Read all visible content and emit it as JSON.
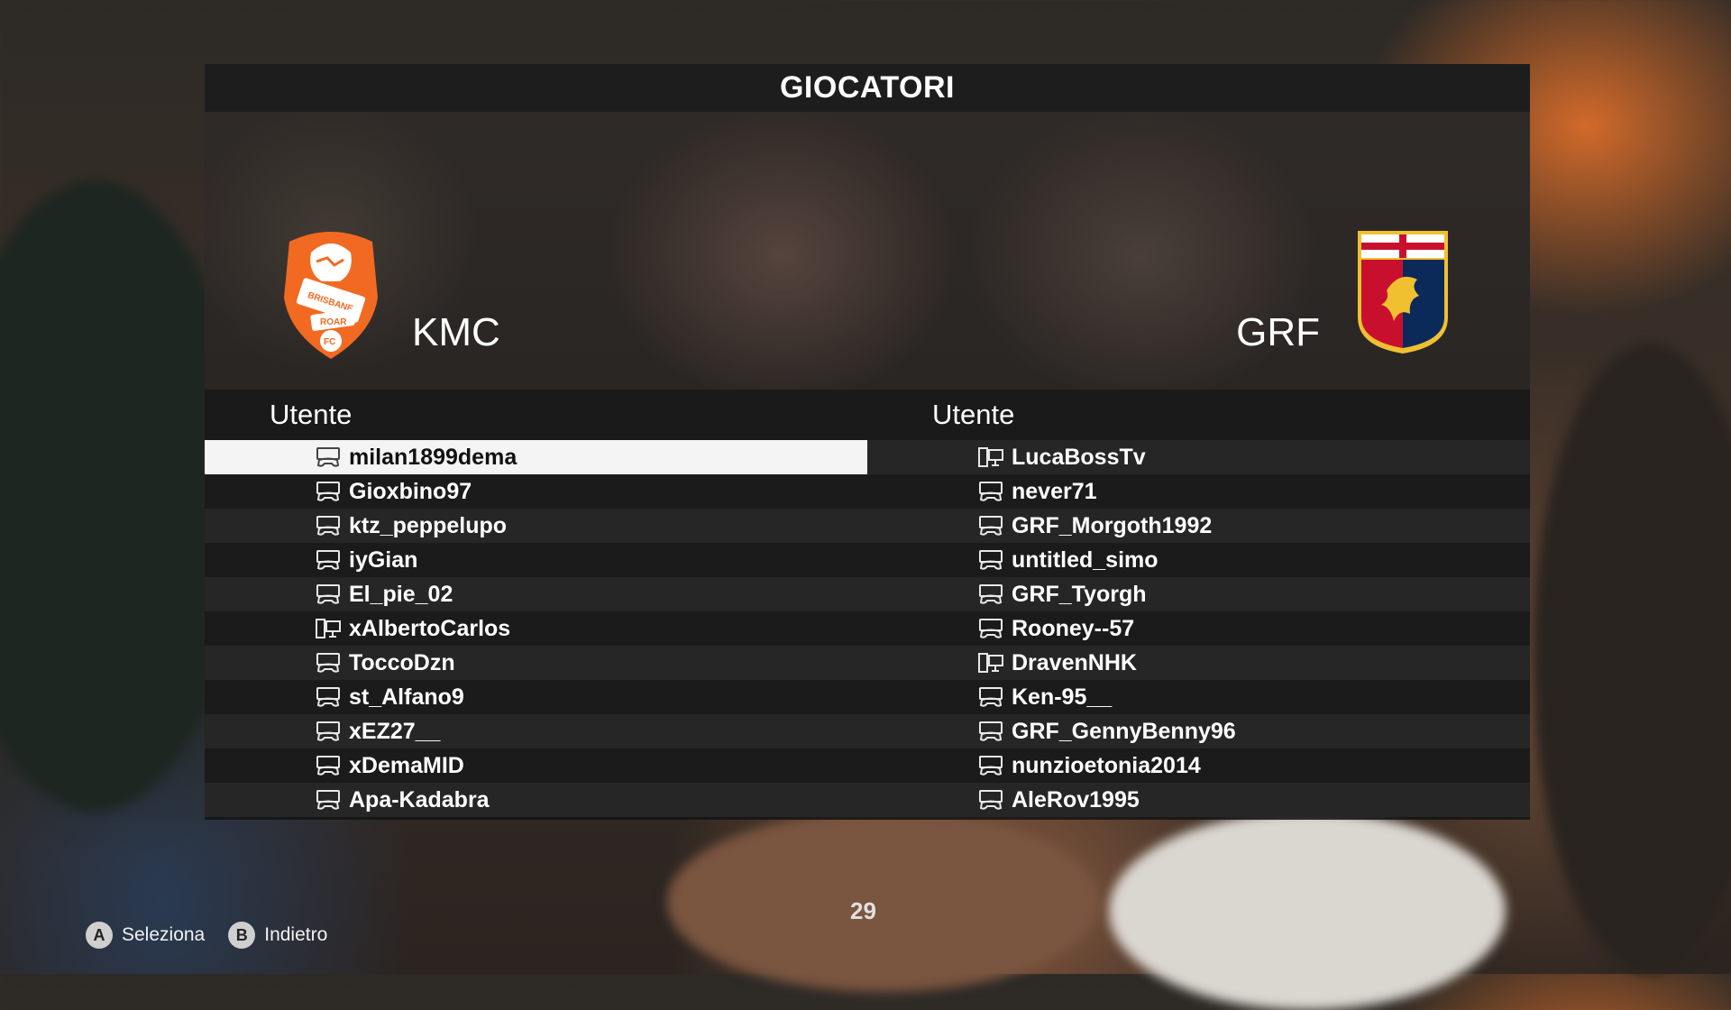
{
  "title": "GIOCATORI",
  "teams": {
    "left": {
      "name": "KMC",
      "crest": "brisbane-roar-crest",
      "crest_text": [
        "BRISBANE",
        "ROAR",
        "FC"
      ],
      "color": "#f26a21"
    },
    "right": {
      "name": "GRF",
      "crest": "genoa-crest",
      "color": "#c8102e"
    }
  },
  "columns": {
    "left_header": "Utente",
    "right_header": "Utente"
  },
  "left_players": [
    {
      "name": "milan1899dema",
      "device": "controller",
      "selected": true
    },
    {
      "name": "Gioxbino97",
      "device": "controller"
    },
    {
      "name": "ktz_peppelupo",
      "device": "controller"
    },
    {
      "name": "iyGian",
      "device": "controller"
    },
    {
      "name": "El_pie_02",
      "device": "controller"
    },
    {
      "name": "xAlbertoCarlos",
      "device": "pc"
    },
    {
      "name": "ToccoDzn",
      "device": "controller"
    },
    {
      "name": "st_Alfano9",
      "device": "controller"
    },
    {
      "name": "xEZ27__",
      "device": "controller"
    },
    {
      "name": "xDemaMID",
      "device": "controller"
    },
    {
      "name": "Apa-Kadabra",
      "device": "controller"
    }
  ],
  "right_players": [
    {
      "name": "LucaBossTv",
      "device": "pc"
    },
    {
      "name": "never71",
      "device": "controller"
    },
    {
      "name": "GRF_Morgoth1992",
      "device": "controller"
    },
    {
      "name": "untitled_simo",
      "device": "controller"
    },
    {
      "name": "GRF_Tyorgh",
      "device": "controller"
    },
    {
      "name": "Rooney--57",
      "device": "controller"
    },
    {
      "name": "DravenNHK",
      "device": "pc"
    },
    {
      "name": "Ken-95__",
      "device": "controller"
    },
    {
      "name": "GRF_GennyBenny96",
      "device": "controller"
    },
    {
      "name": "nunzioetonia2014",
      "device": "controller"
    },
    {
      "name": "AleRov1995",
      "device": "controller"
    }
  ],
  "page_number": "29",
  "hints": [
    {
      "button": "A",
      "label": "Seleziona"
    },
    {
      "button": "B",
      "label": "Indietro"
    }
  ]
}
